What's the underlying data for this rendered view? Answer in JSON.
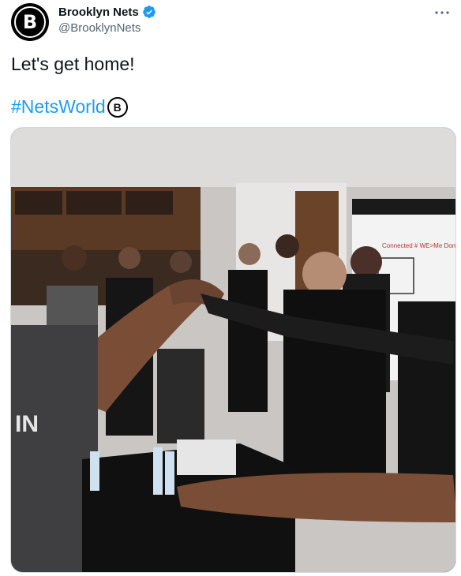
{
  "author": {
    "display_name": "Brooklyn Nets",
    "handle": "@BrooklynNets",
    "avatar_icon": "nets-logo-icon",
    "verified_icon": "verified-badge-icon"
  },
  "tweet": {
    "text": "Let's get home!",
    "hashtag": "#NetsWorld",
    "hashtag_emoji_icon": "nets-logo-icon"
  },
  "media": {
    "type": "photo",
    "icon": "locker-room-huddle-photo",
    "whiteboard_text": "Connected # WE>Me Dome"
  },
  "colors": {
    "link": "#1d9bf0",
    "verified": "#1d9bf0",
    "secondary_text": "#536471"
  }
}
